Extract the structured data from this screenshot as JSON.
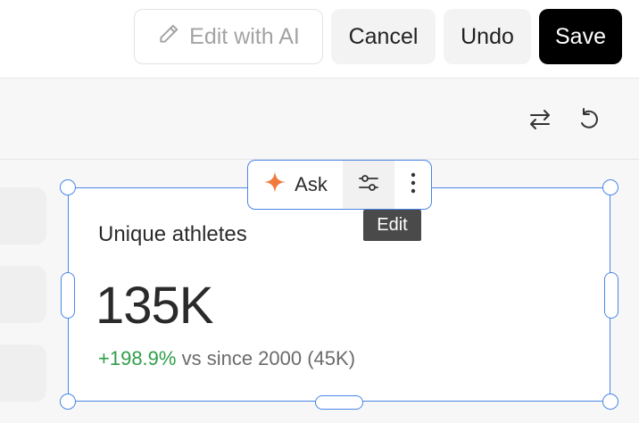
{
  "header": {
    "edit_ai_label": "Edit with AI",
    "cancel_label": "Cancel",
    "undo_label": "Undo",
    "save_label": "Save"
  },
  "card": {
    "title": "Unique athletes",
    "value": "135K",
    "delta_positive": "+198.9%",
    "delta_rest": "vs since 2000 (45K)"
  },
  "floating_toolbar": {
    "ask_label": "Ask",
    "tooltip": "Edit"
  },
  "colors": {
    "selection": "#4a86e8",
    "positive": "#2e9e4a",
    "ask_star": "#f07a3c",
    "save_bg": "#000000"
  }
}
